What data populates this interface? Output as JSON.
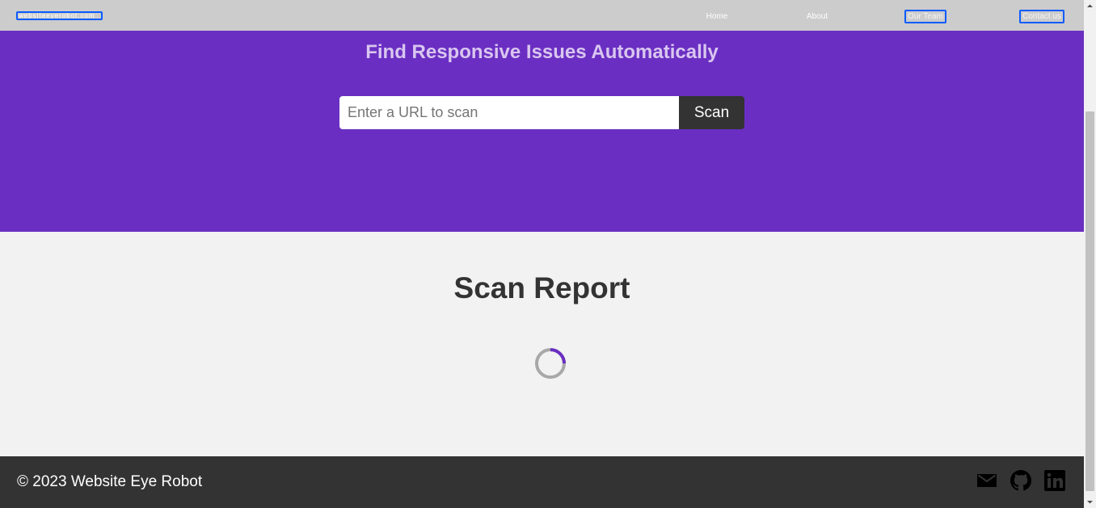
{
  "navbar": {
    "logo_text": "websiteeyerobot.com",
    "links": [
      {
        "label": "Home"
      },
      {
        "label": "About"
      },
      {
        "label": "Our Team"
      },
      {
        "label": "Contact us"
      }
    ]
  },
  "hero": {
    "title": "Find Responsive Issues Automatically",
    "search": {
      "placeholder": "Enter a URL to scan",
      "value": "",
      "button_label": "Scan"
    }
  },
  "report": {
    "title": "Scan Report",
    "loading": true
  },
  "footer": {
    "copyright": "© 2023 Website Eye Robot",
    "icons": [
      "mail-icon",
      "github-icon",
      "linkedin-icon"
    ]
  },
  "colors": {
    "brand_purple": "#6a2fc2",
    "navbar_gray": "#cccccc",
    "dark": "#333333",
    "focus_outline": "#0a5bff"
  }
}
